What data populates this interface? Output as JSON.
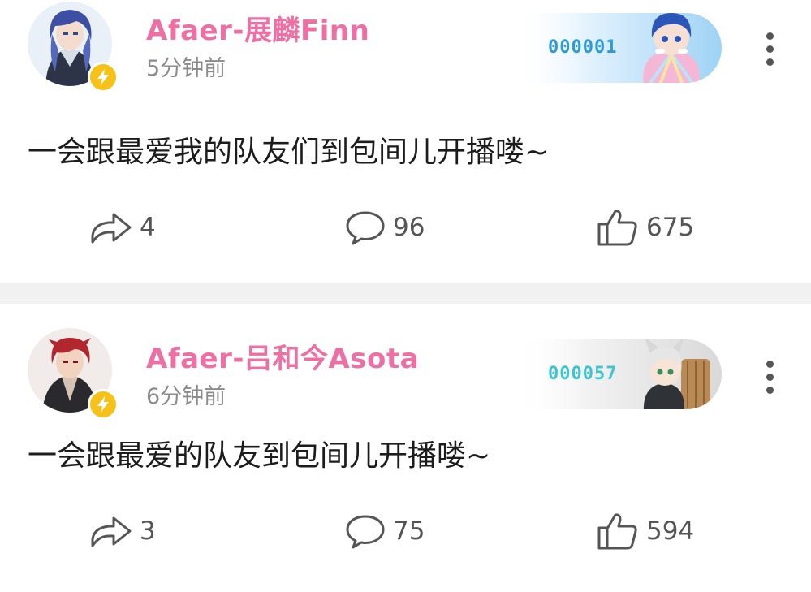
{
  "posts": [
    {
      "username": "Afaer-展麟Finn",
      "time": "5分钟前",
      "fan_number": "000001",
      "fan_number_color": "#2f9bd6",
      "content": "一会跟最爱我的队友们到包间儿开播喽~",
      "shares": "4",
      "comments": "96",
      "likes": "675"
    },
    {
      "username": "Afaer-吕和今Asota",
      "time": "6分钟前",
      "fan_number": "000057",
      "fan_number_color": "#3cc6d0",
      "content": "一会跟最爱的队友到包间儿开播喽~",
      "shares": "3",
      "comments": "75",
      "likes": "594"
    }
  ],
  "colors": {
    "username": "#ee6fa4",
    "verify_badge": "#f6c21a",
    "separator": "#f1f1f1"
  },
  "icons": {
    "share": "share-arrow-icon",
    "comment": "speech-bubble-icon",
    "like": "thumbs-up-icon",
    "more": "vertical-dots-icon",
    "verified": "lightning-bolt-icon"
  }
}
